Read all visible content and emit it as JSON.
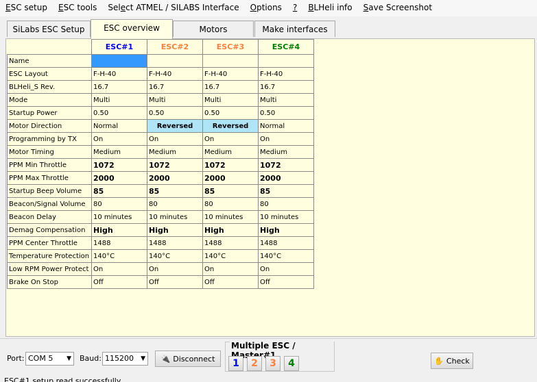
{
  "menu": [
    {
      "acc": "E",
      "rest": "SC setup"
    },
    {
      "acc": "E",
      "rest": "SC tools"
    },
    {
      "acc": "",
      "rest": "Select ATMEL / SILABS Interface",
      "pre": "Sel",
      "accMid": "e",
      "post": "ct ATMEL / SILABS Interface"
    },
    {
      "acc": "O",
      "rest": "ptions"
    },
    {
      "acc": "?",
      "rest": ""
    },
    {
      "acc": "B",
      "rest": "LHeli info"
    },
    {
      "acc": "S",
      "rest": "ave Screenshot"
    }
  ],
  "tabs": [
    "SiLabs ESC Setup",
    "ESC overview",
    "Motors",
    "Make interfaces"
  ],
  "esc_headers": [
    {
      "label": "ESC#1",
      "color": "#0000ff"
    },
    {
      "label": "ESC#2",
      "color": "#ff8040"
    },
    {
      "label": "ESC#3",
      "color": "#ff8040"
    },
    {
      "label": "ESC#4",
      "color": "#008000"
    }
  ],
  "rows": [
    {
      "label": "Name",
      "values": [
        "",
        "",
        "",
        ""
      ]
    },
    {
      "label": "ESC Layout",
      "values": [
        "F-H-40",
        "F-H-40",
        "F-H-40",
        "F-H-40"
      ]
    },
    {
      "label": "BLHeli_S Rev.",
      "values": [
        "16.7",
        "16.7",
        "16.7",
        "16.7"
      ]
    },
    {
      "label": "Mode",
      "values": [
        "Multi",
        "Multi",
        "Multi",
        "Multi"
      ]
    },
    {
      "label": "Startup Power",
      "values": [
        "0.50",
        "0.50",
        "0.50",
        "0.50"
      ]
    },
    {
      "label": "Motor Direction",
      "values": [
        "Normal",
        "Reversed",
        "Reversed",
        "Normal"
      ]
    },
    {
      "label": "Programming by TX",
      "values": [
        "On",
        "On",
        "On",
        "On"
      ]
    },
    {
      "label": "Motor Timing",
      "values": [
        "Medium",
        "Medium",
        "Medium",
        "Medium"
      ]
    },
    {
      "label": "PPM Min Throttle",
      "values": [
        "1072",
        "1072",
        "1072",
        "1072"
      ]
    },
    {
      "label": "PPM Max Throttle",
      "values": [
        "2000",
        "2000",
        "2000",
        "2000"
      ]
    },
    {
      "label": "Startup Beep Volume",
      "values": [
        "85",
        "85",
        "85",
        "85"
      ]
    },
    {
      "label": "Beacon/Signal Volume",
      "values": [
        "80",
        "80",
        "80",
        "80"
      ]
    },
    {
      "label": "Beacon Delay",
      "values": [
        "10 minutes",
        "10 minutes",
        "10 minutes",
        "10 minutes"
      ]
    },
    {
      "label": "Demag Compensation",
      "values": [
        "High",
        "High",
        "High",
        "High"
      ]
    },
    {
      "label": "PPM Center Throttle",
      "values": [
        "1488",
        "1488",
        "1488",
        "1488"
      ]
    },
    {
      "label": "Temperature Protection",
      "values": [
        "140°C",
        "140°C",
        "140°C",
        "140°C"
      ]
    },
    {
      "label": "Low RPM Power Protect",
      "values": [
        "On",
        "On",
        "On",
        "On"
      ]
    },
    {
      "label": "Brake On Stop",
      "values": [
        "Off",
        "Off",
        "Off",
        "Off"
      ]
    }
  ],
  "bottom": {
    "port_label": "Port:",
    "port_value": "COM 5",
    "baud_label": "Baud:",
    "baud_value": "115200",
    "disconnect_label": "Disconnect",
    "multi_title": "Multiple ESC / Master#1",
    "esc_buttons": [
      {
        "label": "1",
        "color": "#0000ff"
      },
      {
        "label": "2",
        "color": "#ff8040"
      },
      {
        "label": "3",
        "color": "#ff8040"
      },
      {
        "label": "4",
        "color": "#008000"
      }
    ],
    "check_label": "Check"
  },
  "status": "ESC#1 setup read successfully",
  "icons": {
    "disconnect": "plug-icon",
    "check": "hand-icon"
  }
}
